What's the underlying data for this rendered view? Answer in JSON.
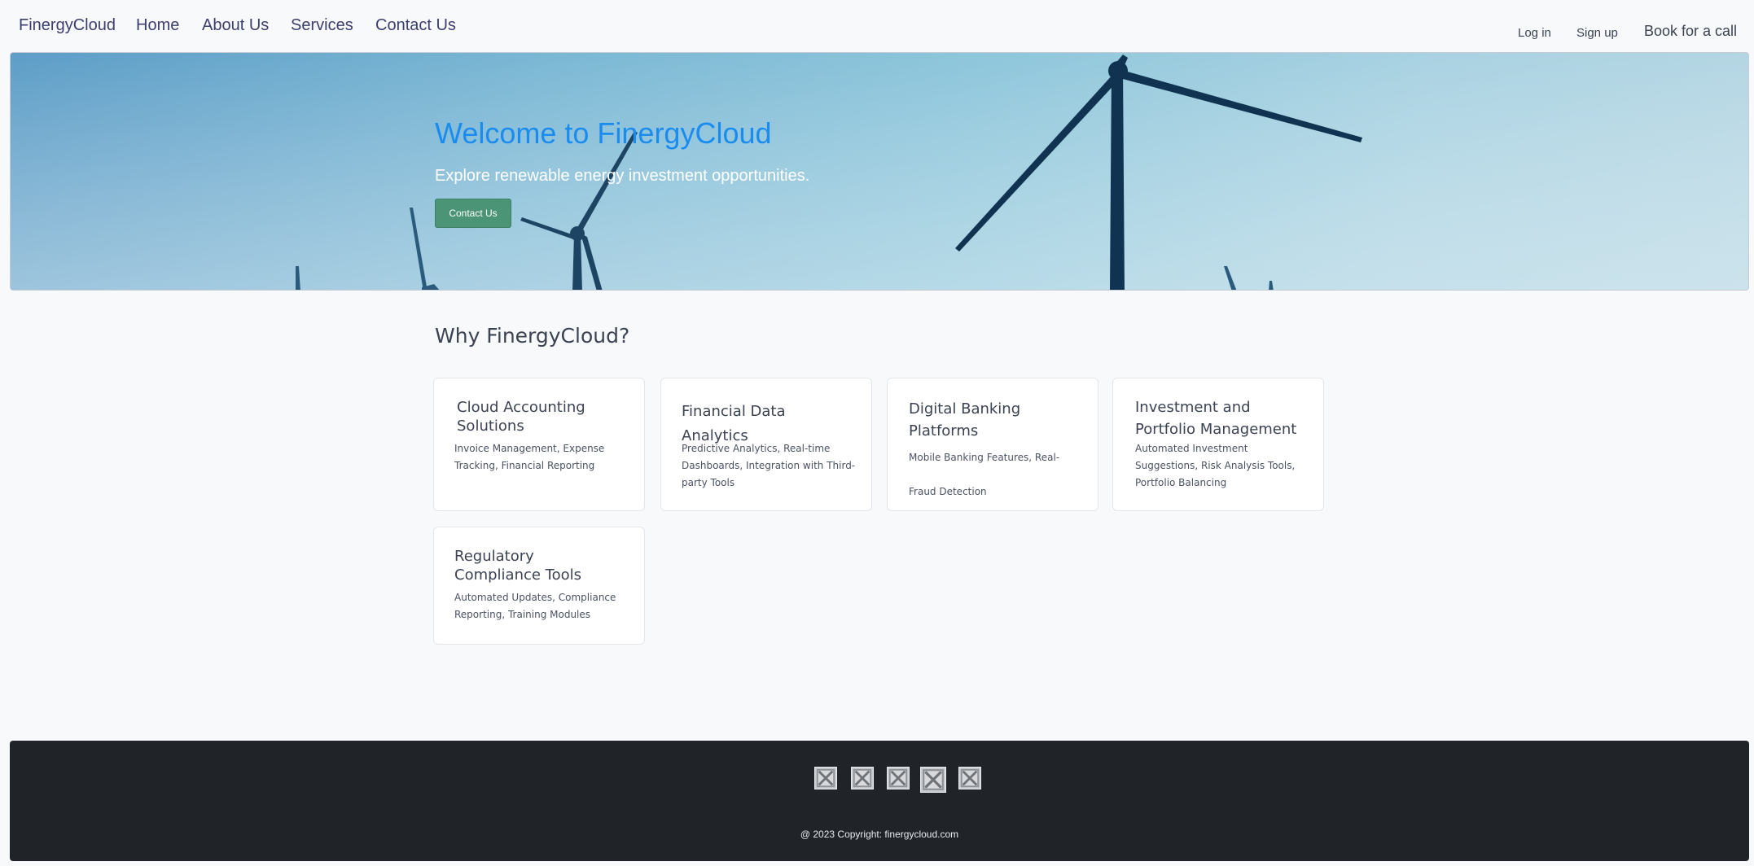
{
  "nav": {
    "brand": "FinergyCloud",
    "links": [
      "Home",
      "About Us",
      "Services",
      "Contact Us"
    ],
    "login": "Log in",
    "signup": "Sign up",
    "book": "Book for a call"
  },
  "hero": {
    "title": "Welcome to FinergyCloud",
    "subtitle": "Explore renewable energy investment opportunities.",
    "button": "Contact Us",
    "background_icon": "wind-turbine-icon"
  },
  "why": {
    "title": "Why FinergyCloud?",
    "cards": [
      {
        "title": "Cloud Accounting Solutions",
        "desc": "Invoice Management, Expense Tracking, Financial Reporting"
      },
      {
        "title": "Financial Data Analytics",
        "desc": "Predictive Analytics, Real-time Dashboards, Integration with Third-party Tools"
      },
      {
        "title": "Digital Banking Platforms",
        "desc": "Mobile Banking Features, Real-Fraud Detection"
      },
      {
        "title": "Investment and Portfolio Management",
        "desc": "Automated Investment Suggestions, Risk Analysis Tools, Portfolio Balancing"
      },
      {
        "title": "Regulatory Compliance Tools",
        "desc": "Automated Updates, Compliance Reporting, Training Modules"
      }
    ]
  },
  "footer": {
    "social_icons": [
      "broken-image-icon",
      "broken-image-icon",
      "broken-image-icon",
      "broken-image-icon",
      "broken-image-icon"
    ],
    "copyright": "@ 2023 Copyright: finergycloud.com"
  },
  "colors": {
    "hero_title": "#1a8cf0",
    "button": "#4b9476",
    "footer_bg": "#202428",
    "page_bg": "#f8f9fa"
  }
}
